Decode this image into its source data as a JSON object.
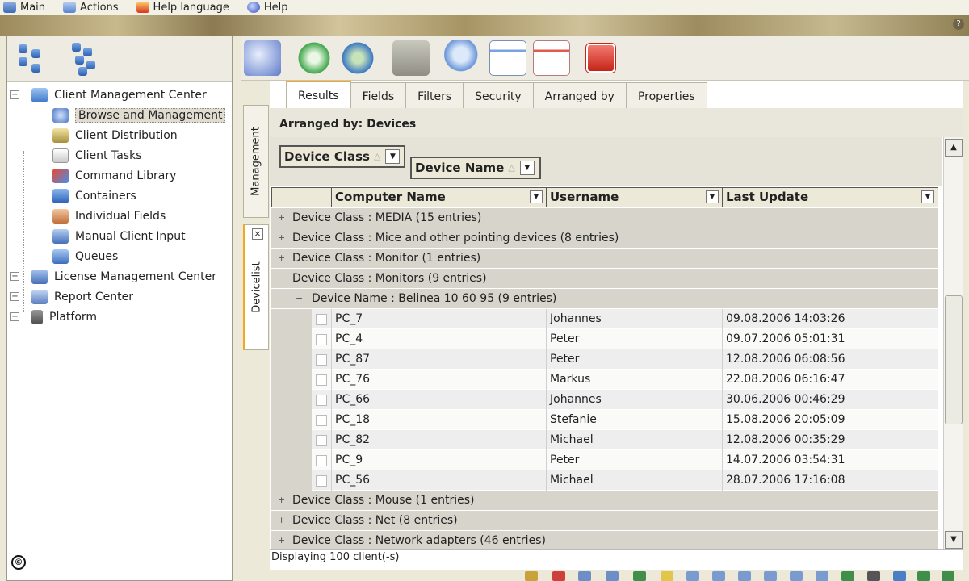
{
  "menu": [
    {
      "label": "Main",
      "icon": "main-icon"
    },
    {
      "label": "Actions",
      "icon": "actions-icon"
    },
    {
      "label": "Help language",
      "icon": "help-language-icon"
    },
    {
      "label": "Help",
      "icon": "help-icon"
    }
  ],
  "banner": {
    "help_glyph": "?"
  },
  "tree": {
    "items": [
      {
        "label": "Client Management Center",
        "icon": "client-management-icon",
        "expander": "−"
      },
      {
        "label": "Browse and Management",
        "icon": "browse-icon"
      },
      {
        "label": "Client Distribution",
        "icon": "distribution-icon"
      },
      {
        "label": "Client Tasks",
        "icon": "tasks-icon"
      },
      {
        "label": "Command Library",
        "icon": "command-library-icon"
      },
      {
        "label": "Containers",
        "icon": "containers-icon"
      },
      {
        "label": "Individual Fields",
        "icon": "fields-icon"
      },
      {
        "label": "Manual Client Input",
        "icon": "manual-input-icon"
      },
      {
        "label": "Queues",
        "icon": "queues-icon"
      },
      {
        "label": "License Management Center",
        "icon": "license-icon",
        "expander": "+"
      },
      {
        "label": "Report Center",
        "icon": "report-icon",
        "expander": "+"
      },
      {
        "label": "Platform",
        "icon": "platform-icon",
        "expander": "+"
      }
    ]
  },
  "side_tabs": {
    "management": "Management",
    "devicelist": "Devicelist",
    "close_glyph": "×"
  },
  "tabs": [
    "Results",
    "Fields",
    "Filters",
    "Security",
    "Arranged by",
    "Properties"
  ],
  "arranged_by": "Arranged by: Devices",
  "group_chips": {
    "device_class": "Device Class",
    "device_name": "Device Name",
    "sort_glyph": "△",
    "dropdown_glyph": "▼"
  },
  "columns": [
    "Computer Name",
    "Username",
    "Last Update"
  ],
  "groups_before": [
    "Device Class : MEDIA (15 entries)",
    "Device Class : Mice and other pointing devices (8 entries)",
    "Device Class : Monitor (1 entries)",
    "Device Class : Monitors (9 entries)"
  ],
  "subgroup": "Device Name : Belinea 10 60 95 (9 entries)",
  "rows": [
    {
      "computer": "PC_7",
      "user": "Johannes",
      "updated": "09.08.2006 14:03:26"
    },
    {
      "computer": "PC_4",
      "user": "Peter",
      "updated": "09.07.2006 05:01:31"
    },
    {
      "computer": "PC_87",
      "user": "Peter",
      "updated": "12.08.2006 06:08:56"
    },
    {
      "computer": "PC_76",
      "user": "Markus",
      "updated": "22.08.2006 06:16:47"
    },
    {
      "computer": "PC_66",
      "user": "Johannes",
      "updated": "30.06.2006 00:46:29"
    },
    {
      "computer": "PC_18",
      "user": "Stefanie",
      "updated": "15.08.2006 20:05:09"
    },
    {
      "computer": "PC_82",
      "user": "Michael",
      "updated": "12.08.2006 00:35:29"
    },
    {
      "computer": "PC_9",
      "user": "Peter",
      "updated": "14.07.2006 03:54:31"
    },
    {
      "computer": "PC_56",
      "user": "Michael",
      "updated": "28.07.2006 17:16:08"
    }
  ],
  "groups_after": [
    "Device Class : Mouse (1 entries)",
    "Device Class : Net (8 entries)",
    "Device Class : Network adapters (46 entries)"
  ],
  "status": "Displaying 100 client(-s)",
  "copyright_glyph": "©",
  "colors": {
    "tab_accent": "#f3a71f",
    "group_row": "#d6d4cb",
    "background": "#ece9d8"
  }
}
